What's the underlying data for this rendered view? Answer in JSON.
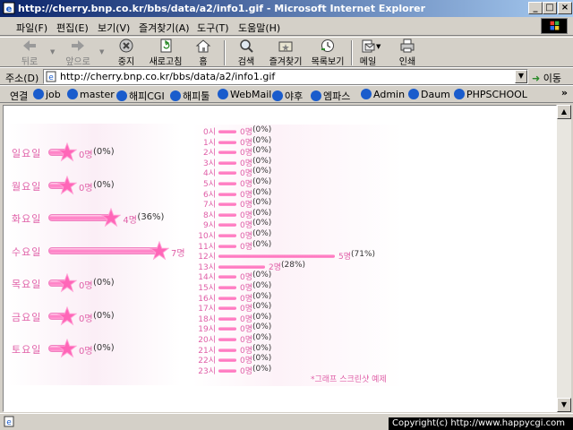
{
  "window": {
    "title": "http://cherry.bnp.co.kr/bbs/data/a2/info1.gif - Microsoft Internet Explorer",
    "min_glyph": "_",
    "max_glyph": "□",
    "close_glyph": "×"
  },
  "menu": [
    "파일(F)",
    "편집(E)",
    "보기(V)",
    "즐겨찾기(A)",
    "도구(T)",
    "도움말(H)"
  ],
  "toolbar": {
    "back": "뒤로",
    "forward": "앞으로",
    "stop": "중지",
    "refresh": "새로고침",
    "home": "홈",
    "search": "검색",
    "favorites": "즐겨찾기",
    "history": "목록보기",
    "mail": "메일",
    "print": "인쇄"
  },
  "address": {
    "label": "주소(D)",
    "url": "http://cherry.bnp.co.kr/bbs/data/a2/info1.gif",
    "go": "이동"
  },
  "links": {
    "label": "연결",
    "items": [
      "job",
      "master",
      "해피CGI",
      "해피툴",
      "WebMail",
      "야후",
      "엠파스",
      "Admin",
      "Daum",
      "PHPSCHOOL"
    ],
    "more": "»"
  },
  "chart_data": [
    {
      "type": "bar",
      "categories": [
        "일요일",
        "월요일",
        "화요일",
        "수요일",
        "목요일",
        "금요일",
        "토요일"
      ],
      "values": [
        0,
        0,
        4,
        7,
        0,
        0,
        0
      ],
      "count_labels": [
        "0명",
        "0명",
        "4명",
        "7명",
        "0명",
        "0명",
        "0명"
      ],
      "pct_labels": [
        "(0%)",
        "(0%)",
        "(36%)",
        "",
        "(0%)",
        "(0%)",
        "(0%)"
      ],
      "xlim": [
        0,
        7
      ]
    },
    {
      "type": "bar",
      "categories": [
        "0시",
        "1시",
        "2시",
        "3시",
        "4시",
        "5시",
        "6시",
        "7시",
        "8시",
        "9시",
        "10시",
        "11시",
        "12시",
        "13시",
        "14시",
        "15시",
        "16시",
        "17시",
        "18시",
        "19시",
        "20시",
        "21시",
        "22시",
        "23시"
      ],
      "values": [
        0,
        0,
        0,
        0,
        0,
        0,
        0,
        0,
        0,
        0,
        0,
        0,
        5,
        2,
        0,
        0,
        0,
        0,
        0,
        0,
        0,
        0,
        0,
        0
      ],
      "count_labels": [
        "0명",
        "0명",
        "0명",
        "0명",
        "0명",
        "0명",
        "0명",
        "0명",
        "0명",
        "0명",
        "0명",
        "0명",
        "5명",
        "2명",
        "0명",
        "0명",
        "0명",
        "0명",
        "0명",
        "0명",
        "0명",
        "0명",
        "0명",
        "0명"
      ],
      "pct_labels": [
        "(0%)",
        "(0%)",
        "(0%)",
        "(0%)",
        "(0%)",
        "(0%)",
        "(0%)",
        "(0%)",
        "(0%)",
        "(0%)",
        "(0%)",
        "(0%)",
        "(71%)",
        "(28%)",
        "(0%)",
        "(0%)",
        "(0%)",
        "(0%)",
        "(0%)",
        "(0%)",
        "(0%)",
        "(0%)",
        "(0%)",
        "(0%)"
      ],
      "xlim": [
        0,
        5
      ],
      "caption": "*그래프 스크린샷 예제"
    }
  ],
  "colors": {
    "accent": "#ff6cba",
    "label": "#e060a8"
  },
  "status": {
    "copyright": "Copyright(c) http://www.happycgi.com"
  }
}
